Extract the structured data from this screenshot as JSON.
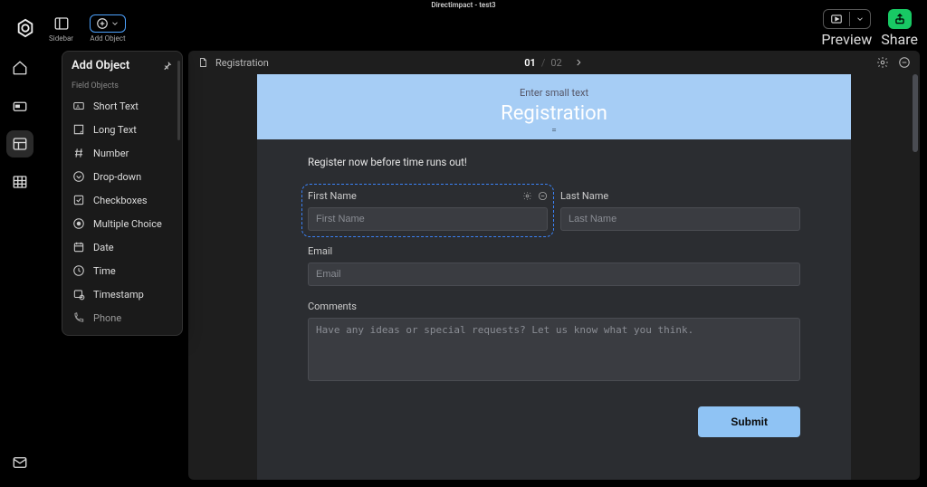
{
  "project_title": "Directimpact - test3",
  "header": {
    "sidebar_label": "Sidebar",
    "add_object_label": "Add Object",
    "preview_label": "Preview",
    "share_label": "Share"
  },
  "panel": {
    "title": "Add Object",
    "section": "Field Objects",
    "items": [
      {
        "icon": "short-text",
        "label": "Short Text"
      },
      {
        "icon": "long-text",
        "label": "Long Text"
      },
      {
        "icon": "hash",
        "label": "Number"
      },
      {
        "icon": "dropdown",
        "label": "Drop-down"
      },
      {
        "icon": "checkbox",
        "label": "Checkboxes"
      },
      {
        "icon": "radio",
        "label": "Multiple Choice"
      },
      {
        "icon": "calendar",
        "label": "Date"
      },
      {
        "icon": "clock",
        "label": "Time"
      },
      {
        "icon": "timestamp",
        "label": "Timestamp"
      },
      {
        "icon": "phone",
        "label": "Phone"
      }
    ]
  },
  "canvas": {
    "doc_name": "Registration",
    "pager": {
      "current": "01",
      "total": "02"
    },
    "header": {
      "small": "Enter small text",
      "title": "Registration"
    },
    "intro": "Register now before time runs out!",
    "fields": {
      "first_name": {
        "label": "First Name",
        "placeholder": "First Name"
      },
      "last_name": {
        "label": "Last Name",
        "placeholder": "Last Name"
      },
      "email": {
        "label": "Email",
        "placeholder": "Email"
      },
      "comments": {
        "label": "Comments",
        "placeholder": "Have any ideas or special requests? Let us know what you think."
      }
    },
    "submit": "Submit"
  }
}
